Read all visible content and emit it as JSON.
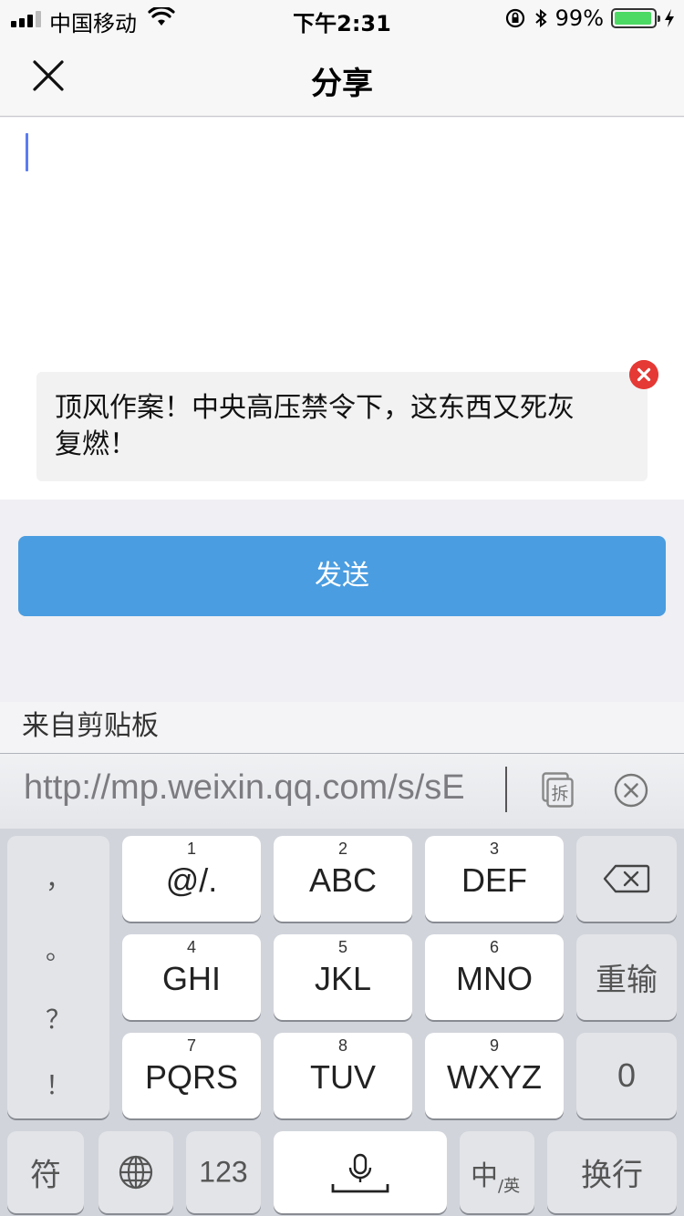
{
  "status_bar": {
    "carrier": "中国移动",
    "time": "下午2:31",
    "battery": "99%",
    "battery_level": 0.99
  },
  "nav": {
    "title": "分享",
    "close_icon": "close-icon"
  },
  "compose": {
    "preview_title": "顶风作案！中央高压禁令下，这东西又死灰复燃！"
  },
  "send_button": "发送",
  "clipboard": {
    "label": "来自剪贴板",
    "url": "http://mp.weixin.qq.com/s/sE",
    "split_glyph": "拆"
  },
  "keyboard": {
    "punctuation": [
      "，",
      "。",
      "？",
      "！"
    ],
    "keys": [
      {
        "num": "1",
        "label": "@/."
      },
      {
        "num": "2",
        "label": "ABC"
      },
      {
        "num": "3",
        "label": "DEF"
      },
      {
        "num": "4",
        "label": "GHI"
      },
      {
        "num": "5",
        "label": "JKL"
      },
      {
        "num": "6",
        "label": "MNO"
      },
      {
        "num": "7",
        "label": "PQRS"
      },
      {
        "num": "8",
        "label": "TUV"
      },
      {
        "num": "9",
        "label": "WXYZ"
      }
    ],
    "reenter": "重输",
    "zero": "0",
    "symbol": "符",
    "numbers": "123",
    "lang_main": "中",
    "lang_sub": "/英",
    "return": "换行"
  }
}
